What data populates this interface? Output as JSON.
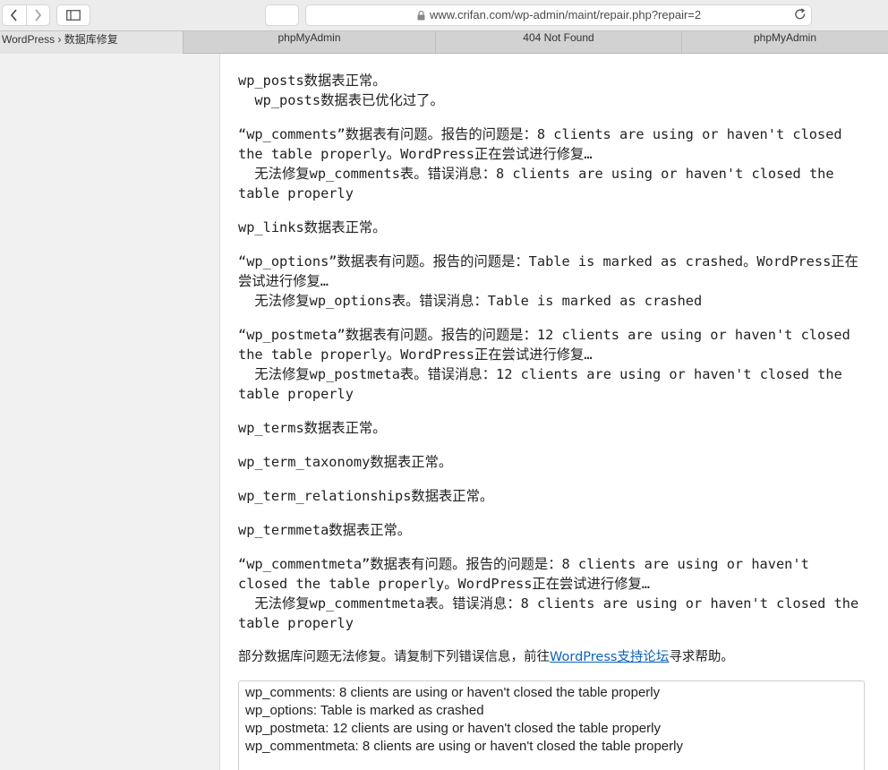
{
  "toolbar": {
    "url": "www.crifan.com/wp-admin/maint/repair.php?repair=2"
  },
  "tabs": [
    {
      "label": "WordPress › 数据库修复"
    },
    {
      "label": "phpMyAdmin"
    },
    {
      "label": "404 Not Found"
    },
    {
      "label": "phpMyAdmin"
    }
  ],
  "repair": {
    "entries": [
      {
        "status": "wp_posts数据表正常。",
        "detail": "  wp_posts数据表已优化过了。"
      },
      {
        "status": "“wp_comments”数据表有问题。报告的问题是：8 clients are using or haven't closed the table properly。WordPress正在尝试进行修复…",
        "detail": "  无法修复wp_comments表。错误消息：8 clients are using or haven't closed the table properly"
      },
      {
        "status": "wp_links数据表正常。",
        "detail": ""
      },
      {
        "status": "“wp_options”数据表有问题。报告的问题是：Table is marked as crashed。WordPress正在尝试进行修复…",
        "detail": "  无法修复wp_options表。错误消息：Table is marked as crashed"
      },
      {
        "status": "“wp_postmeta”数据表有问题。报告的问题是：12 clients are using or haven't closed the table properly。WordPress正在尝试进行修复…",
        "detail": "  无法修复wp_postmeta表。错误消息：12 clients are using or haven't closed the table properly"
      },
      {
        "status": "wp_terms数据表正常。",
        "detail": ""
      },
      {
        "status": "wp_term_taxonomy数据表正常。",
        "detail": ""
      },
      {
        "status": "wp_term_relationships数据表正常。",
        "detail": ""
      },
      {
        "status": "wp_termmeta数据表正常。",
        "detail": ""
      },
      {
        "status": "“wp_commentmeta”数据表有问题。报告的问题是：8 clients are using or haven't closed the table properly。WordPress正在尝试进行修复…",
        "detail": "  无法修复wp_commentmeta表。错误消息：8 clients are using or haven't closed the table properly"
      }
    ],
    "final_before": "部分数据库问题无法修复。请复制下列错误信息，前往",
    "final_link": "WordPress支持论坛",
    "final_after": "寻求帮助。",
    "error_lines": [
      "wp_comments: 8 clients are using or haven't closed the table properly",
      "wp_options: Table is marked as crashed",
      "wp_postmeta: 12 clients are using or haven't closed the table properly",
      "wp_commentmeta: 8 clients are using or haven't closed the table properly"
    ]
  }
}
